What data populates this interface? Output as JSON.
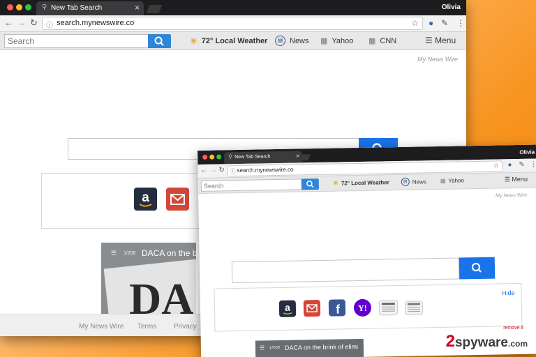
{
  "browser": {
    "tab_title": "New Tab Search",
    "profile": "Olivia",
    "url": "search.mynewswire.co"
  },
  "toolbar": {
    "search_placeholder": "Search",
    "weather": "72° Local Weather",
    "news": "News",
    "yahoo": "Yahoo",
    "cnn": "CNN",
    "menu": "Menu"
  },
  "page": {
    "brand": "My News Wire",
    "news_counter": "1/200",
    "news_caption": "DACA on the brink of elimi",
    "news_image_text": "DA",
    "hide_label": "Hide",
    "footer_links": [
      "My News Wire",
      "Terms",
      "Privacy"
    ]
  },
  "shortcuts": [
    "amazon",
    "gmail",
    "facebook",
    "yahoo",
    "news",
    "newspaper"
  ],
  "colors": {
    "search_button": "#1a73e8",
    "toolbar_search_button": "#2f86d9",
    "amazon": "#232f3e",
    "gmail": "#d44638",
    "facebook": "#3b5998",
    "yahoo": "#6001d2",
    "watermark": "#d0021b"
  },
  "watermark": {
    "prefix": "2",
    "text": "spyware",
    "suffix": ".com",
    "sub": "remove it"
  }
}
